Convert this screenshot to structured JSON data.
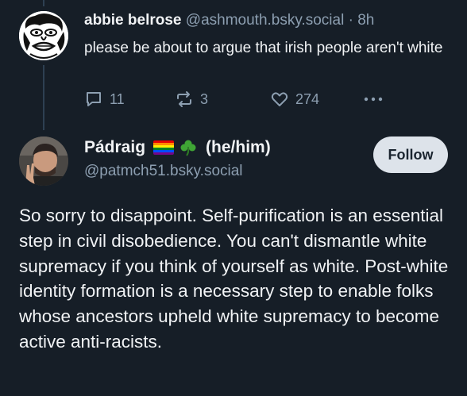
{
  "reply_post": {
    "author_name": "abbie belrose",
    "author_handle": "@ashmouth.bsky.social",
    "separator": "·",
    "time": "8h",
    "text": "please be about to argue that irish people aren't white",
    "reply_count": "11",
    "repost_count": "3",
    "like_count": "274",
    "icons": [
      "reply-icon",
      "repost-icon",
      "like-icon",
      "more-icon"
    ]
  },
  "main_post": {
    "author_name": "Pádraig",
    "author_flags": [
      "rainbow-flag-icon",
      "shamrock-icon"
    ],
    "pronouns": "(he/him)",
    "author_handle": "@patmch51.bsky.social",
    "follow_label": "Follow",
    "text": "So sorry to disappoint. Self-purification is an essential step in civil disobedience. You can't dismantle white supremacy if you think of yourself as white. Post-white identity formation is a necessary step to enable folks whose ancestors upheld white supremacy to become active anti-racists."
  },
  "colors": {
    "background": "#161e27",
    "muted_text": "#8d9fb1",
    "primary_text": "#f1f3f5",
    "follow_button_bg": "#dde3ea",
    "thread_line": "#2e4052"
  }
}
